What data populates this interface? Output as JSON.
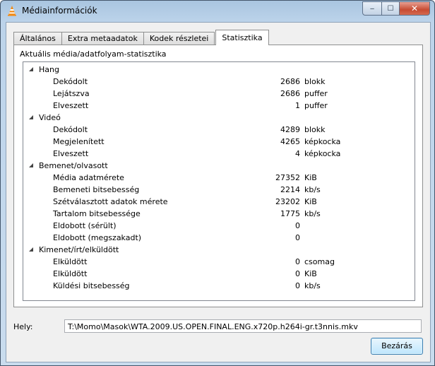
{
  "window": {
    "title": "Médiainformációk",
    "icon": "vlc-cone-icon",
    "controls": {
      "minimize": "‒",
      "maximize": "☐",
      "close": "✕"
    }
  },
  "tabs": [
    {
      "label": "Általános"
    },
    {
      "label": "Extra metaadatok"
    },
    {
      "label": "Kodek részletei"
    },
    {
      "label": "Statisztika",
      "active": true
    }
  ],
  "stats": {
    "heading": "Aktuális média/adatfolyam-statisztika",
    "groups": [
      {
        "label": "Hang",
        "items": [
          {
            "label": "Dekódolt",
            "value": "2686",
            "unit": "blokk"
          },
          {
            "label": "Lejátszva",
            "value": "2686",
            "unit": "puffer"
          },
          {
            "label": "Elveszett",
            "value": "1",
            "unit": "puffer"
          }
        ]
      },
      {
        "label": "Videó",
        "items": [
          {
            "label": "Dekódolt",
            "value": "4289",
            "unit": "blokk"
          },
          {
            "label": "Megjelenített",
            "value": "4265",
            "unit": "képkocka"
          },
          {
            "label": "Elveszett",
            "value": "4",
            "unit": "képkocka"
          }
        ]
      },
      {
        "label": "Bemenet/olvasott",
        "items": [
          {
            "label": "Média adatmérete",
            "value": "27352",
            "unit": "KiB"
          },
          {
            "label": "Bemeneti bitsebesség",
            "value": "2214",
            "unit": "kb/s"
          },
          {
            "label": "Szétválasztott adatok mérete",
            "value": "23202",
            "unit": "KiB"
          },
          {
            "label": "Tartalom bitsebessége",
            "value": "1775",
            "unit": "kb/s"
          },
          {
            "label": "Eldobott (sérült)",
            "value": "0",
            "unit": ""
          },
          {
            "label": "Eldobott (megszakadt)",
            "value": "0",
            "unit": ""
          }
        ]
      },
      {
        "label": "Kimenet/írt/elküldött",
        "items": [
          {
            "label": "Elküldött",
            "value": "0",
            "unit": "csomag"
          },
          {
            "label": "Elküldött",
            "value": "0",
            "unit": "KiB"
          },
          {
            "label": "Küldési bitsebesség",
            "value": "0",
            "unit": "kb/s"
          }
        ]
      }
    ]
  },
  "location": {
    "label": "Hely:",
    "value": "T:\\Momo\\Masok\\WTA.2009.US.OPEN.FINAL.ENG.x720p.h264i-gr.t3nnis.mkv"
  },
  "buttons": {
    "close_label": "Bezárás"
  }
}
